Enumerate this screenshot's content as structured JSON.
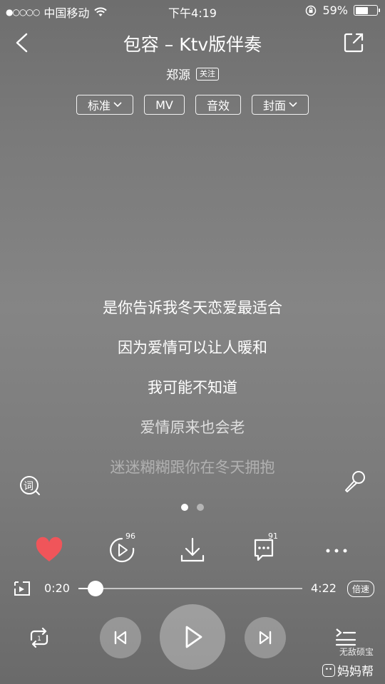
{
  "status_bar": {
    "carrier": "中国移动",
    "signal": "●○○○○",
    "time": "下午4:19",
    "battery_percent": "59%",
    "battery_level": 0.59
  },
  "header": {
    "title": "包容 – Ktv版伴奏",
    "artist": "郑源",
    "follow_label": "关注"
  },
  "options": [
    {
      "label": "标准",
      "dropdown": true
    },
    {
      "label": "MV",
      "dropdown": false
    },
    {
      "label": "音效",
      "dropdown": false
    },
    {
      "label": "封面",
      "dropdown": true
    }
  ],
  "lyrics": [
    {
      "text": "是你告诉我冬天恋爱最适合",
      "opacity": 1.0
    },
    {
      "text": "因为爱情可以让人暖和",
      "opacity": 1.0
    },
    {
      "text": "我可能不知道",
      "opacity": 1.0
    },
    {
      "text": "爱情原来也会老",
      "opacity": 0.75
    },
    {
      "text": "迷迷糊糊跟你在冬天拥抱",
      "opacity": 0.4
    }
  ],
  "lyric_icon_text": "词",
  "pages": {
    "count": 2,
    "current": 0
  },
  "actions": {
    "play_count_badge": "96",
    "comment_count_badge": "91",
    "like_color": "#f0555a"
  },
  "progress": {
    "current": "0:20",
    "total": "4:22",
    "fraction": 0.076,
    "speed_label": "倍速"
  },
  "watermark": {
    "line1": "无敌硕宝",
    "line2": "妈妈帮"
  }
}
